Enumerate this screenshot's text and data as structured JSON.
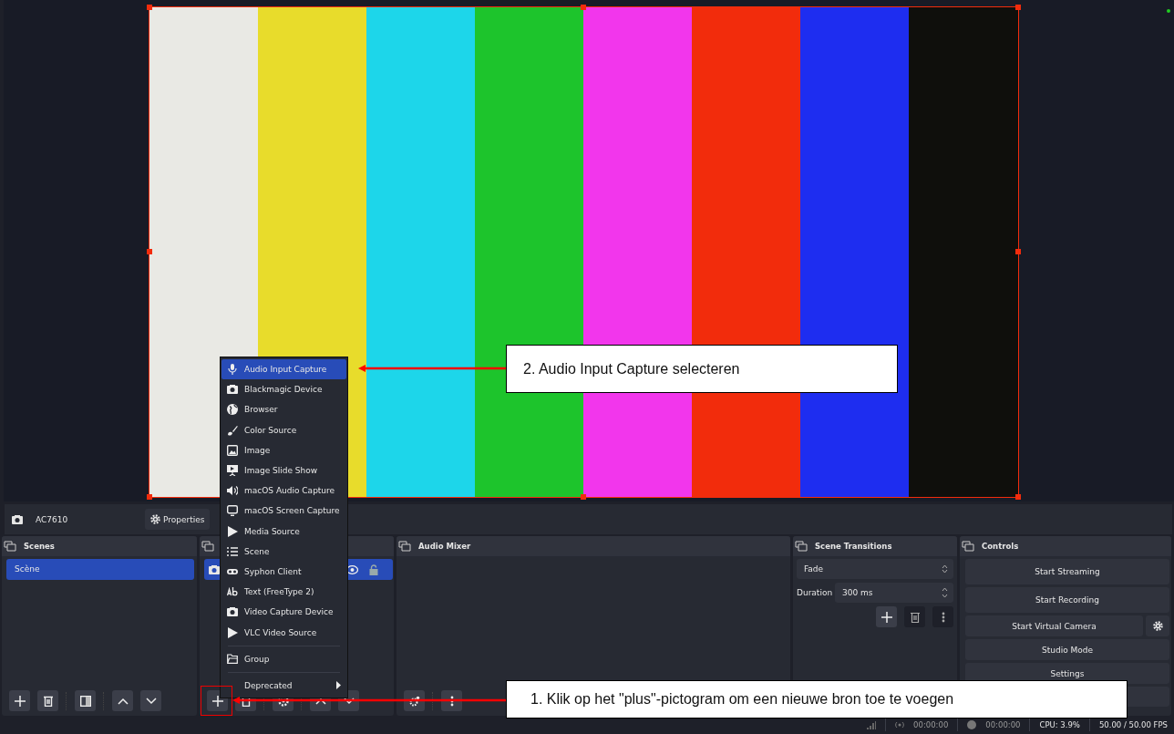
{
  "preview": {
    "bars": [
      {
        "color": "#e9e9e4"
      },
      {
        "color": "#e8dc2b"
      },
      {
        "color": "#1dd6ea"
      },
      {
        "color": "#1dc42c"
      },
      {
        "color": "#f236ec"
      },
      {
        "color": "#f22c0c"
      },
      {
        "color": "#1e2df0"
      },
      {
        "color": "#0f0f0c"
      }
    ]
  },
  "source_toolbar": {
    "source_name": "AC7610",
    "properties_button": "Properties"
  },
  "scenes": {
    "title": "Scenes",
    "items": [
      {
        "label": "Scène",
        "selected": true
      }
    ]
  },
  "sources": {
    "items": [
      {
        "selected": true,
        "visible": true,
        "locked": false
      }
    ]
  },
  "audio_mixer": {
    "title": "Audio Mixer"
  },
  "scene_transitions": {
    "title": "Scene Transitions",
    "transition": "Fade",
    "duration_label": "Duration",
    "duration": "300 ms"
  },
  "controls": {
    "title": "Controls",
    "buttons": [
      {
        "label": "Start Streaming"
      },
      {
        "label": "Start Recording"
      },
      {
        "label": "Start Virtual Camera"
      },
      {
        "label": "Studio Mode"
      },
      {
        "label": "Settings"
      }
    ]
  },
  "status_bar": {
    "stream_time": "00:00:00",
    "record_time": "00:00:00",
    "cpu": "CPU: 3.9%",
    "fps": "50.00 / 50.00 FPS"
  },
  "context_menu": {
    "items": [
      {
        "kind": "source",
        "label": "Audio Input Capture",
        "selected": true
      },
      {
        "kind": "source",
        "label": "Blackmagic Device",
        "selected": false
      },
      {
        "kind": "source",
        "label": "Browser",
        "selected": false
      },
      {
        "kind": "source",
        "label": "Color Source",
        "selected": false
      },
      {
        "kind": "source",
        "label": "Image",
        "selected": false
      },
      {
        "kind": "source",
        "label": "Image Slide Show",
        "selected": false
      },
      {
        "kind": "source",
        "label": "macOS Audio Capture",
        "selected": false
      },
      {
        "kind": "source",
        "label": "macOS Screen Capture",
        "selected": false
      },
      {
        "kind": "source",
        "label": "Media Source",
        "selected": false
      },
      {
        "kind": "source",
        "label": "Scene",
        "selected": false
      },
      {
        "kind": "source",
        "label": "Syphon Client",
        "selected": false
      },
      {
        "kind": "source",
        "label": "Text (FreeType 2)",
        "selected": false
      },
      {
        "kind": "source",
        "label": "Video Capture Device",
        "selected": false
      },
      {
        "kind": "source",
        "label": "VLC Video Source",
        "selected": false
      },
      {
        "kind": "group",
        "label": "Group",
        "selected": false
      },
      {
        "kind": "submenu",
        "label": "Deprecated",
        "selected": false
      }
    ]
  },
  "annotations": [
    {
      "text": "2. Audio Input Capture selecteren"
    },
    {
      "text": "1. Klik op het \"plus\"-pictogram om een nieuwe bron toe te voegen"
    }
  ]
}
